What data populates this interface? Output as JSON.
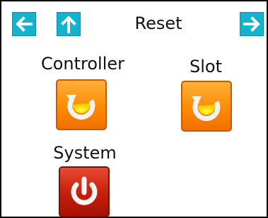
{
  "header": {
    "title": "Reset",
    "nav": {
      "back_icon": "arrow-left-icon",
      "up_icon": "arrow-up-icon",
      "forward_icon": "arrow-right-icon"
    }
  },
  "actions": [
    {
      "label": "Controller",
      "icon": "refresh-icon",
      "color": "#ff8a00"
    },
    {
      "label": "Slot",
      "icon": "refresh-icon",
      "color": "#ff8a00"
    },
    {
      "label": "System",
      "icon": "power-icon",
      "color": "#c8200e"
    }
  ],
  "colors": {
    "nav_accent": "#12b3cf",
    "reset_orange": "#ff8a00",
    "power_red": "#c8200e"
  }
}
